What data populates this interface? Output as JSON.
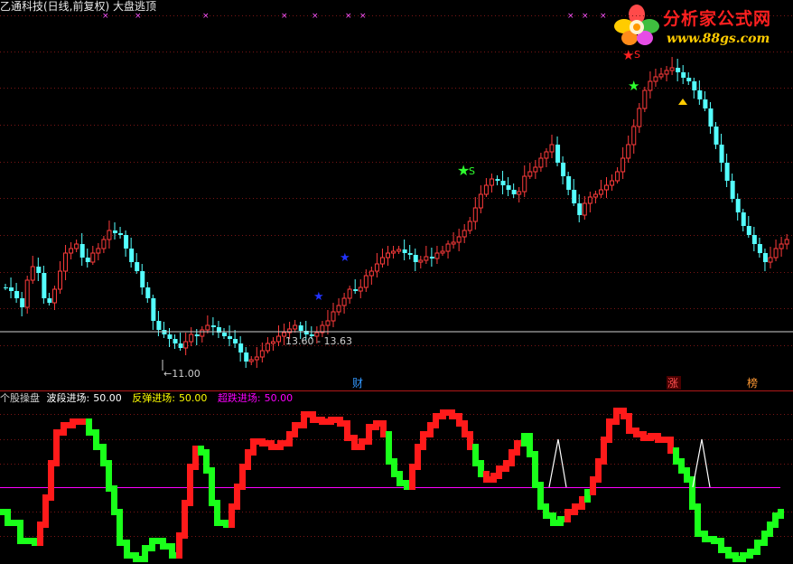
{
  "window": {
    "title": "乙通科技(日线,前复权) 大盘逃顶"
  },
  "logo": {
    "name": "分析家公式网",
    "url": "www.88gs.com"
  },
  "price_annotations": {
    "low_label": "←11.00",
    "range_label": "13.60 - 13.63",
    "signal_s": "S",
    "signal_s2": "S"
  },
  "event_markers": {
    "cai": "财",
    "zhang": "涨",
    "bang": "榜"
  },
  "indicator": {
    "name": "个股操盘",
    "items": [
      {
        "label": "波段进场:",
        "value": "50.00",
        "color": "#ffffff"
      },
      {
        "label": "反弹进场:",
        "value": "50.00",
        "color": "#ffff00"
      },
      {
        "label": "超跌进场:",
        "value": "50.00",
        "color": "#ff00ff"
      }
    ]
  },
  "colors": {
    "up": "#ff3b3b",
    "down": "#54ffff",
    "wave_up": "#ff1a1a",
    "wave_down": "#1aff1a",
    "midline": "#ff00ff",
    "grid": "#8b1a1a"
  },
  "chart_data": {
    "type": "candlestick",
    "price_panel": {
      "low_marker": 11.0,
      "range_label": [
        13.6,
        13.63
      ]
    },
    "indicator_panel": {
      "type": "step_line",
      "reference_level": 50.0
    }
  }
}
